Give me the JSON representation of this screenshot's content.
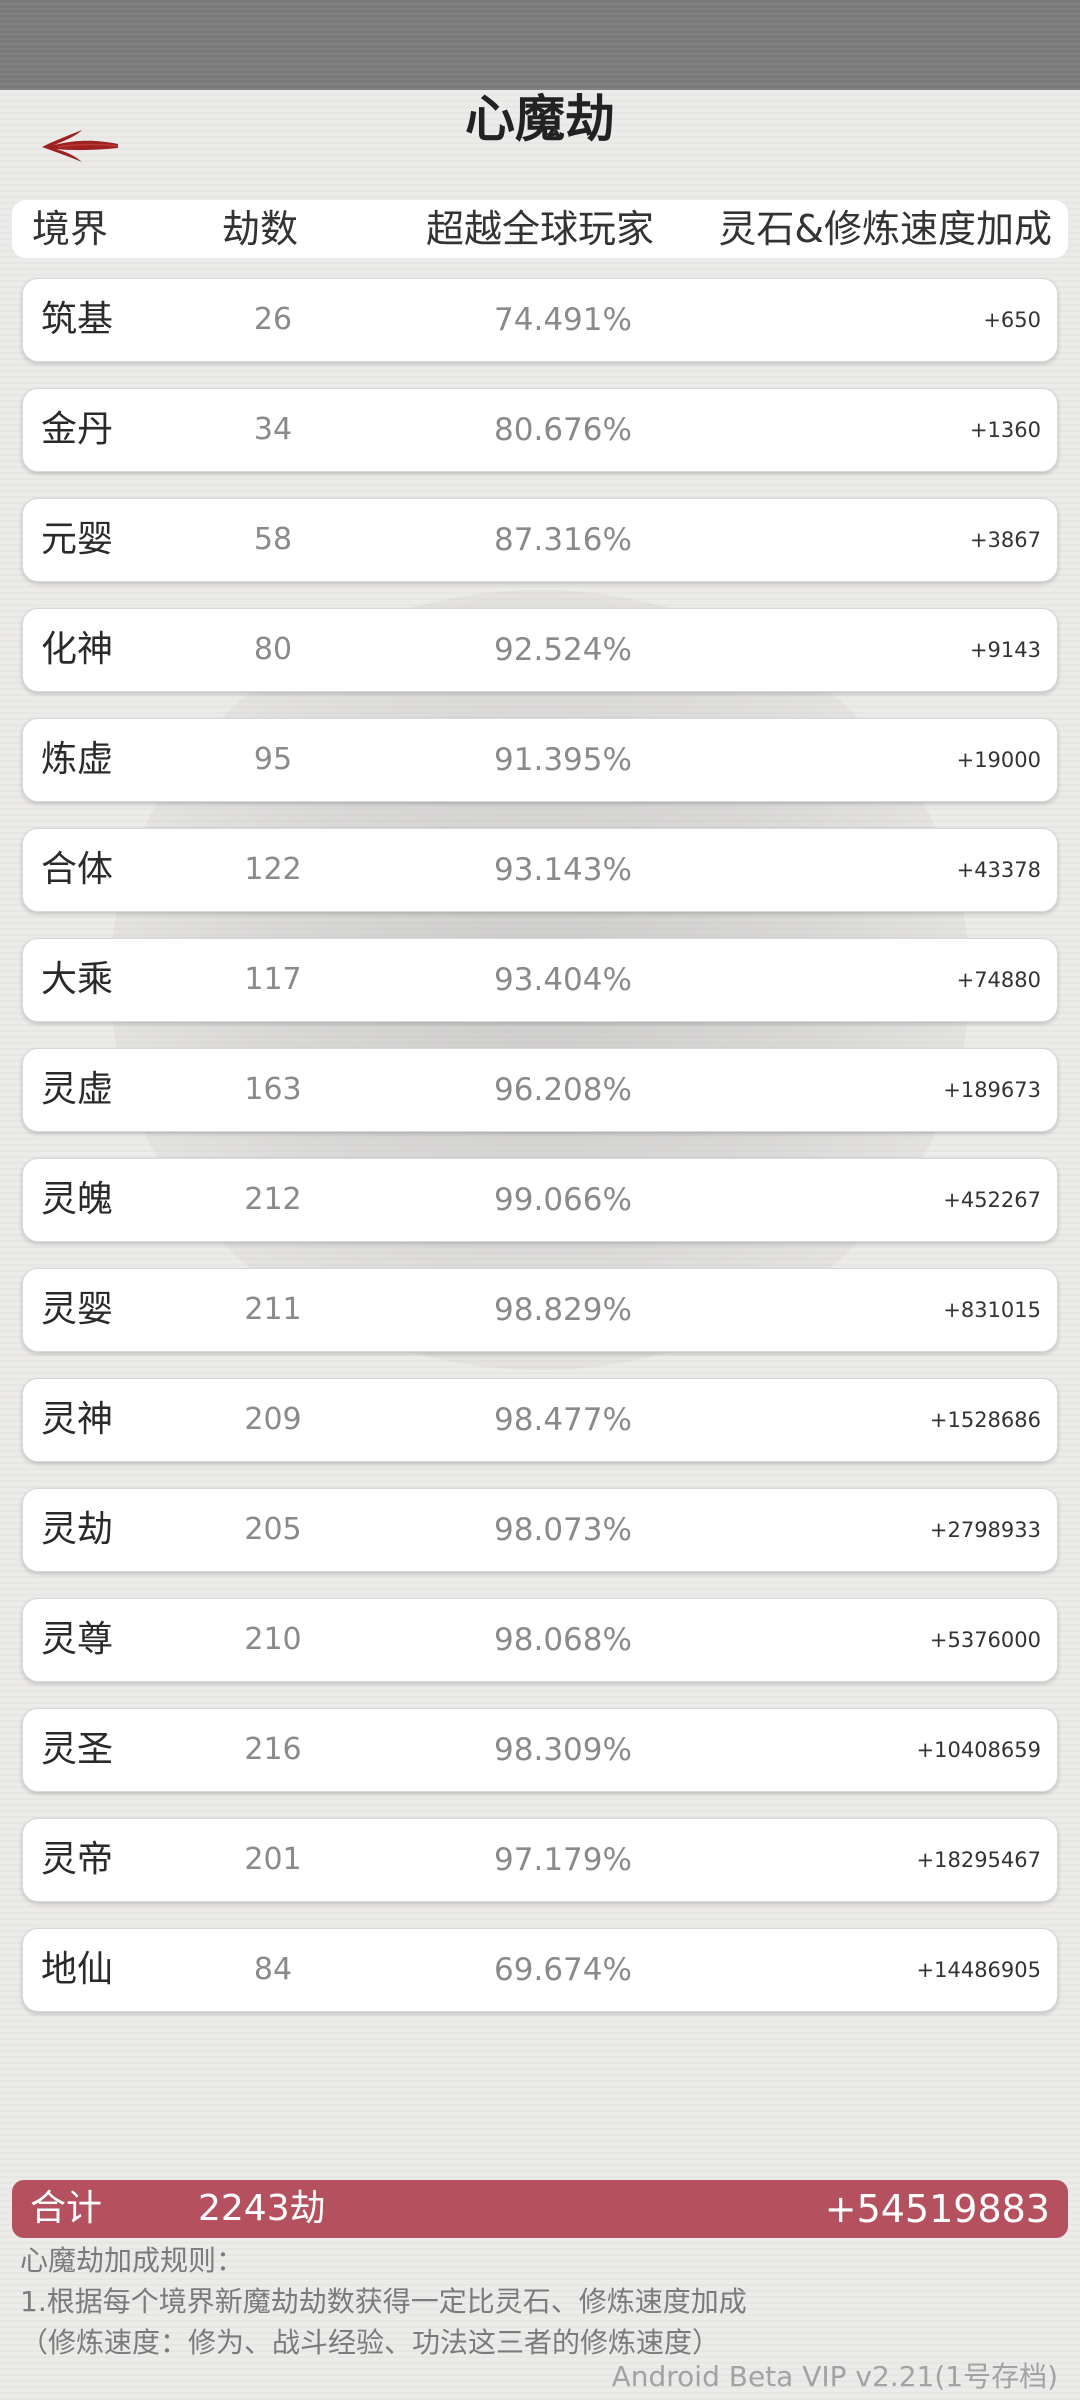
{
  "header": {
    "title": "心魔劫",
    "back_icon": "back-arrow-icon"
  },
  "columns": {
    "realm": "境界",
    "count": "劫数",
    "beyond": "超越全球玩家",
    "bonus": "灵石&修炼速度加成"
  },
  "rows": [
    {
      "realm": "筑基",
      "count": "26",
      "pct": "74.491%",
      "bonus": "+650"
    },
    {
      "realm": "金丹",
      "count": "34",
      "pct": "80.676%",
      "bonus": "+1360"
    },
    {
      "realm": "元婴",
      "count": "58",
      "pct": "87.316%",
      "bonus": "+3867"
    },
    {
      "realm": "化神",
      "count": "80",
      "pct": "92.524%",
      "bonus": "+9143"
    },
    {
      "realm": "炼虚",
      "count": "95",
      "pct": "91.395%",
      "bonus": "+19000"
    },
    {
      "realm": "合体",
      "count": "122",
      "pct": "93.143%",
      "bonus": "+43378"
    },
    {
      "realm": "大乘",
      "count": "117",
      "pct": "93.404%",
      "bonus": "+74880"
    },
    {
      "realm": "灵虚",
      "count": "163",
      "pct": "96.208%",
      "bonus": "+189673"
    },
    {
      "realm": "灵魄",
      "count": "212",
      "pct": "99.066%",
      "bonus": "+452267"
    },
    {
      "realm": "灵婴",
      "count": "211",
      "pct": "98.829%",
      "bonus": "+831015"
    },
    {
      "realm": "灵神",
      "count": "209",
      "pct": "98.477%",
      "bonus": "+1528686"
    },
    {
      "realm": "灵劫",
      "count": "205",
      "pct": "98.073%",
      "bonus": "+2798933"
    },
    {
      "realm": "灵尊",
      "count": "210",
      "pct": "98.068%",
      "bonus": "+5376000"
    },
    {
      "realm": "灵圣",
      "count": "216",
      "pct": "98.309%",
      "bonus": "+10408659"
    },
    {
      "realm": "灵帝",
      "count": "201",
      "pct": "97.179%",
      "bonus": "+18295467"
    },
    {
      "realm": "地仙",
      "count": "84",
      "pct": "69.674%",
      "bonus": "+14486905"
    }
  ],
  "total": {
    "label": "合计",
    "count": "2243劫",
    "bonus": "+54519883"
  },
  "rules": {
    "heading": "心魔劫加成规则：",
    "line1": "1.根据每个境界新魔劫劫数获得一定比灵石、修炼速度加成",
    "line2": "（修炼速度：修为、战斗经验、功法这三者的修炼速度）"
  },
  "version": "Android Beta VIP v2.21(1号存档)",
  "colors": {
    "accent": "#b5505f",
    "back_arrow": "#9e2222"
  }
}
